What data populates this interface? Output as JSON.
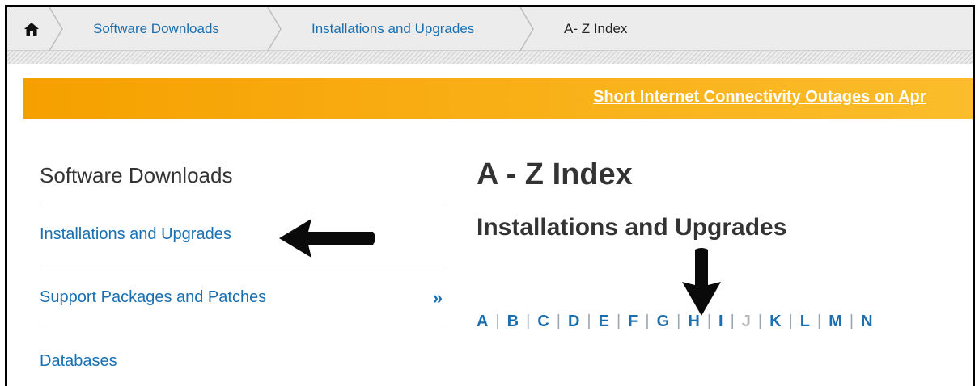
{
  "breadcrumb": {
    "home_icon": "home-icon",
    "items": [
      "Software Downloads",
      "Installations and Upgrades",
      "A- Z Index"
    ]
  },
  "banner": {
    "link_text": "Short Internet Connectivity Outages on Apr"
  },
  "sidebar": {
    "title": "Software Downloads",
    "items": [
      {
        "label": "Installations and Upgrades"
      },
      {
        "label": "Support Packages and Patches",
        "arrow": "»"
      },
      {
        "label": "Databases"
      }
    ]
  },
  "main": {
    "title": "A - Z Index",
    "subtitle": "Installations and Upgrades"
  },
  "alpha_index": {
    "letters": [
      "A",
      "B",
      "C",
      "D",
      "E",
      "F",
      "G",
      "H",
      "I",
      "J",
      "K",
      "L",
      "M",
      "N"
    ],
    "disabled": [
      "J"
    ],
    "separator": "|"
  },
  "colors": {
    "link": "#1a6fb0",
    "banner": "#f6a000",
    "heading": "#333333"
  }
}
